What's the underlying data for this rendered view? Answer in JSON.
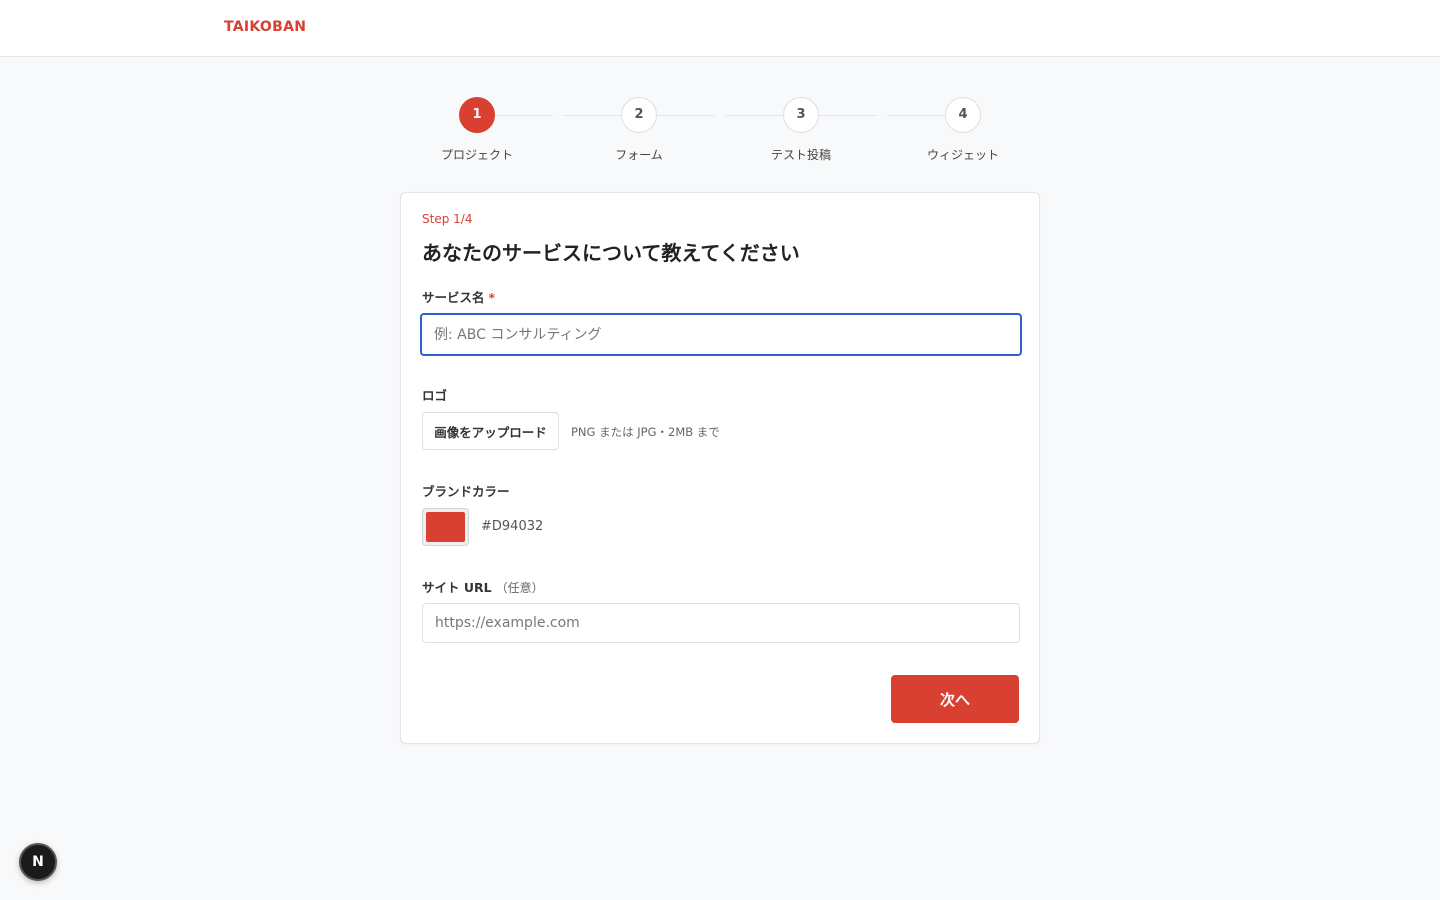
{
  "header": {
    "brand": "TAIKOBAN"
  },
  "stepper": {
    "steps": [
      {
        "number": "1",
        "label": "プロジェクト",
        "active": true
      },
      {
        "number": "2",
        "label": "フォーム",
        "active": false
      },
      {
        "number": "3",
        "label": "テスト投稿",
        "active": false
      },
      {
        "number": "4",
        "label": "ウィジェット",
        "active": false
      }
    ]
  },
  "form": {
    "step_count": "Step 1/4",
    "title": "あなたのサービスについて教えてください",
    "service_name": {
      "label": "サービス名",
      "required_mark": "*",
      "value": "",
      "placeholder": "例: ABC コンサルティング"
    },
    "logo": {
      "label": "ロゴ",
      "upload_button": "画像をアップロード",
      "hint": "PNG または JPG・2MB まで"
    },
    "brand_color": {
      "label": "ブランドカラー",
      "value": "#D94032"
    },
    "site_url": {
      "label": "サイト URL",
      "optional_note": "（任意）",
      "value": "",
      "placeholder": "https://example.com"
    },
    "next_button": "次へ"
  },
  "dev_badge": {
    "letter": "N"
  },
  "colors": {
    "accent": "#d94032",
    "focus_ring": "#2f5fcf",
    "background": "#f8f9fa"
  }
}
